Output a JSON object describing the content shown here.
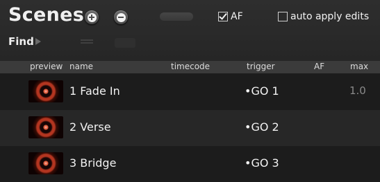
{
  "panel": {
    "title": "Scenes",
    "add_icon": "plus-circle-icon",
    "remove_icon": "minus-circle-icon",
    "af_checkbox": {
      "label": "AF",
      "checked": true
    },
    "auto_apply_checkbox": {
      "label": "auto apply edits",
      "checked": false
    },
    "find_label": "Find"
  },
  "columns": {
    "preview": "preview",
    "name": "name",
    "timecode": "timecode",
    "trigger": "trigger",
    "af": "AF",
    "max": "max"
  },
  "scenes": [
    {
      "name": "1 Fade In",
      "trigger": "•GO 1",
      "max": "1.0"
    },
    {
      "name": "2 Verse",
      "trigger": "•GO 2",
      "max": ""
    },
    {
      "name": "3 Bridge",
      "trigger": "•GO 3",
      "max": ""
    }
  ]
}
